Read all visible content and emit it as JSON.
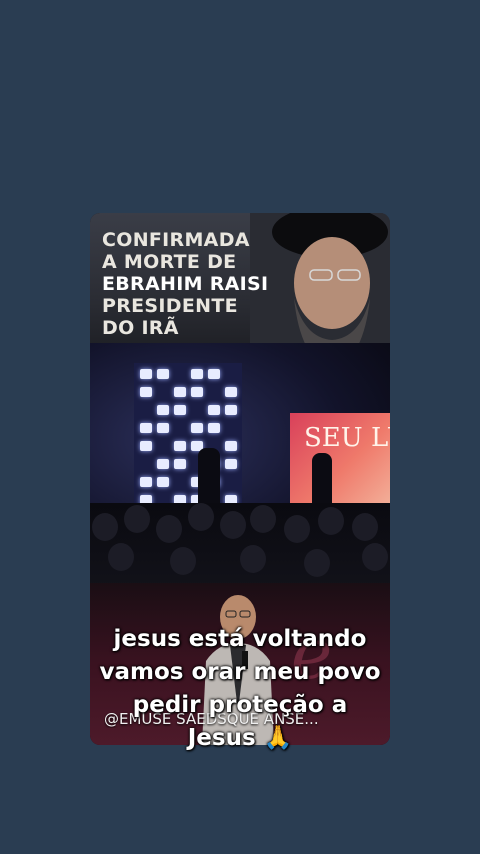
{
  "video": {
    "headline_lines": [
      "CONFIRMADA",
      "A MORTE DE",
      "EBRAHIM RAISI",
      "PRESIDENTE",
      "DO IRÃ"
    ],
    "stage_sign": "SEU LUG",
    "handle": "@EMUSE SAEDSQUE ANSE..."
  },
  "caption": {
    "lines": [
      "jesus está voltando",
      "vamos orar meu povo",
      "pedir proteção a",
      "Jesus 🙏"
    ]
  },
  "colors": {
    "background": "#2a3d52",
    "caption_text": "#ffffff"
  }
}
